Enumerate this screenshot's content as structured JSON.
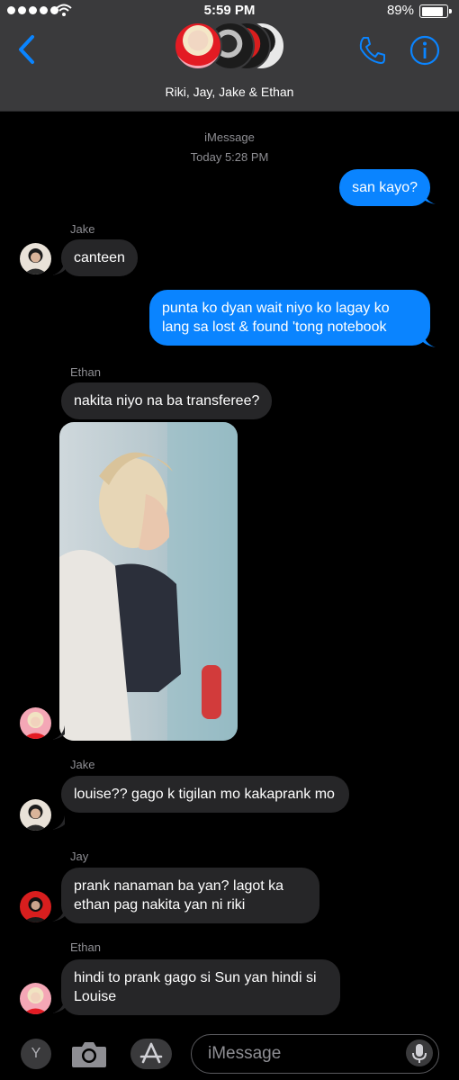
{
  "status_bar": {
    "time": "5:59 PM",
    "battery": "89%",
    "battery_level": 0.89
  },
  "header": {
    "contact_names": "Riki, Jay, Jake & Ethan",
    "icons": {
      "back": "chevron-left-icon",
      "call": "phone-icon",
      "info": "info-icon"
    }
  },
  "thread": {
    "service": "iMessage",
    "timestamp": "Today 5:28 PM",
    "messages": [
      {
        "from": "me",
        "text": "san kayo?"
      },
      {
        "sender": "Jake",
        "text": "canteen"
      },
      {
        "from": "me",
        "text": "punta ko dyan wait niyo ko lagay ko lang sa lost & found 'tong notebook"
      },
      {
        "sender": "Ethan",
        "text": "nakita niyo na ba transferee?"
      },
      {
        "sender": "Jake",
        "text": "louise?? gago k tigilan mo kakaprank mo"
      },
      {
        "sender": "Jay",
        "text": "prank nanaman ba yan? lagot ka ethan pag nakita yan ni riki"
      },
      {
        "sender": "Ethan",
        "text": "hindi to prank gago si Sun yan hindi si Louise"
      }
    ]
  },
  "composer": {
    "apps_button_label": "Y",
    "placeholder": "iMessage",
    "icons": {
      "camera": "camera-icon",
      "appstore": "appstore-icon",
      "mic": "microphone-icon"
    }
  },
  "colors": {
    "accent": "#0a84ff",
    "bubble_in": "#262628",
    "header_bg": "#3a3a3c",
    "meta_text": "#8e8e93"
  }
}
